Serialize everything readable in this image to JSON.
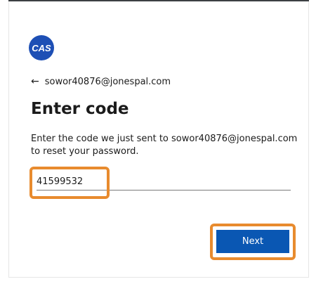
{
  "logo": {
    "text": "CAS",
    "color": "#1d4fb5"
  },
  "back": {
    "icon": "arrow-left-icon",
    "email": "sowor40876@jonespal.com"
  },
  "title": "Enter code",
  "description": "Enter the code we just sent to sowor40876@jonespal.com to reset your password.",
  "code_input": {
    "value": "41599532"
  },
  "next_button": {
    "label": "Next",
    "color": "#0a57b3"
  },
  "highlight_color": "#e88b2e"
}
